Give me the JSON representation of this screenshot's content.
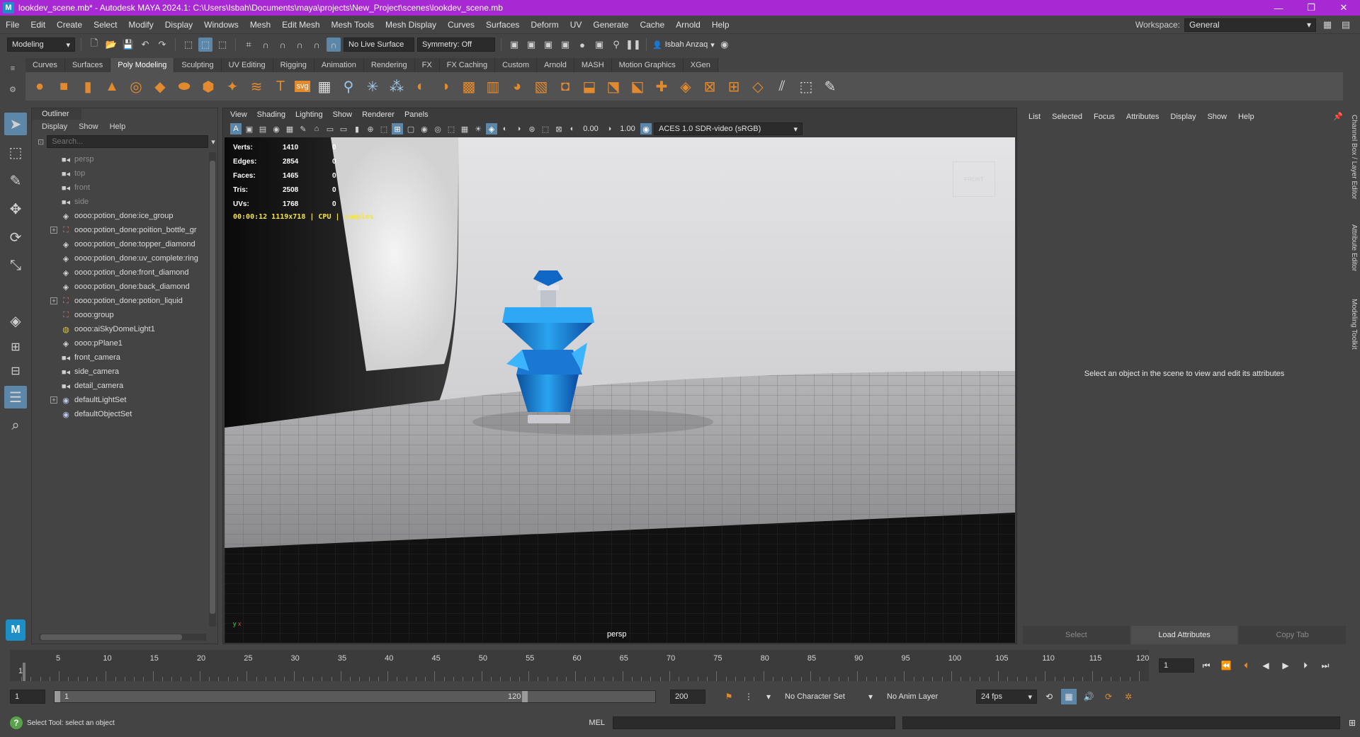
{
  "window": {
    "title": "lookdev_scene.mb* - Autodesk MAYA 2024.1: C:\\Users\\Isbah\\Documents\\maya\\projects\\New_Project\\scenes\\lookdev_scene.mb",
    "minimize": "—",
    "maximize": "❐",
    "close": "✕"
  },
  "menubar": {
    "items": [
      "File",
      "Edit",
      "Create",
      "Select",
      "Modify",
      "Display",
      "Windows",
      "Mesh",
      "Edit Mesh",
      "Mesh Tools",
      "Mesh Display",
      "Curves",
      "Surfaces",
      "Deform",
      "UV",
      "Generate",
      "Cache",
      "Arnold",
      "Help"
    ],
    "workspace_label": "Workspace:",
    "workspace_value": "General"
  },
  "statusline": {
    "menu_set": "Modeling",
    "live_surface": "No Live Surface",
    "symmetry": "Symmetry: Off",
    "user": "Isbah Anzaq"
  },
  "shelf": {
    "tabs": [
      "Curves",
      "Surfaces",
      "Poly Modeling",
      "Sculpting",
      "UV Editing",
      "Rigging",
      "Animation",
      "Rendering",
      "FX",
      "FX Caching",
      "Custom",
      "Arnold",
      "MASH",
      "Motion Graphics",
      "XGen"
    ],
    "active_tab": "Poly Modeling",
    "svg_label": "svg",
    "text_label": "T"
  },
  "outliner": {
    "title": "Outliner",
    "menu": [
      "Display",
      "Show",
      "Help"
    ],
    "search_placeholder": "Search...",
    "items": [
      {
        "label": "persp",
        "icon": "camera-icon",
        "dim": true,
        "expandable": false
      },
      {
        "label": "top",
        "icon": "camera-icon",
        "dim": true,
        "expandable": false
      },
      {
        "label": "front",
        "icon": "camera-icon",
        "dim": true,
        "expandable": false
      },
      {
        "label": "side",
        "icon": "camera-icon",
        "dim": true,
        "expandable": false
      },
      {
        "label": "oooo:potion_done:ice_group",
        "icon": "transform-icon",
        "dim": false,
        "expandable": false
      },
      {
        "label": "oooo:potion_done:poition_bottle_gr",
        "icon": "group-icon",
        "dim": false,
        "expandable": true
      },
      {
        "label": "oooo:potion_done:topper_diamond",
        "icon": "transform-icon",
        "dim": false,
        "expandable": false
      },
      {
        "label": "oooo:potion_done:uv_complete:ring",
        "icon": "transform-icon",
        "dim": false,
        "expandable": false
      },
      {
        "label": "oooo:potion_done:front_diamond",
        "icon": "transform-icon",
        "dim": false,
        "expandable": false
      },
      {
        "label": "oooo:potion_done:back_diamond",
        "icon": "transform-icon",
        "dim": false,
        "expandable": false
      },
      {
        "label": "oooo:potion_done:potion_liquid",
        "icon": "group-icon",
        "dim": false,
        "expandable": true
      },
      {
        "label": "oooo:group",
        "icon": "group-icon",
        "dim": false,
        "expandable": false
      },
      {
        "label": "oooo:aiSkyDomeLight1",
        "icon": "skydome-icon",
        "dim": false,
        "expandable": false
      },
      {
        "label": "oooo:pPlane1",
        "icon": "transform-icon",
        "dim": false,
        "expandable": false
      },
      {
        "label": "front_camera",
        "icon": "camera-icon",
        "dim": false,
        "expandable": false
      },
      {
        "label": "side_camera",
        "icon": "camera-icon",
        "dim": false,
        "expandable": false
      },
      {
        "label": "detail_camera",
        "icon": "camera-icon",
        "dim": false,
        "expandable": false
      },
      {
        "label": "defaultLightSet",
        "icon": "set-icon",
        "dim": false,
        "expandable": true
      },
      {
        "label": "defaultObjectSet",
        "icon": "set-icon",
        "dim": false,
        "expandable": false
      }
    ]
  },
  "viewport": {
    "menu": [
      "View",
      "Shading",
      "Lighting",
      "Show",
      "Renderer",
      "Panels"
    ],
    "exposure": "0.00",
    "gamma": "1.00",
    "color_space": "ACES 1.0 SDR-video (sRGB)",
    "hud": [
      {
        "key": "Verts:",
        "value": "1410",
        "selected": "0"
      },
      {
        "key": "Edges:",
        "value": "2854",
        "selected": "0"
      },
      {
        "key": "Faces:",
        "value": "1465",
        "selected": "0"
      },
      {
        "key": "Tris:",
        "value": "2508",
        "selected": "0"
      },
      {
        "key": "UVs:",
        "value": "1768",
        "selected": "0"
      }
    ],
    "render_info": "00:00:12 1119x718 | CPU | samples",
    "camera_label": "persp",
    "view_cube": "FRONT"
  },
  "attribute_editor": {
    "menu": [
      "List",
      "Selected",
      "Focus",
      "Attributes",
      "Display",
      "Show",
      "Help"
    ],
    "message": "Select an object in the scene to view and edit its attributes",
    "buttons": {
      "select": "Select",
      "load": "Load Attributes",
      "copy": "Copy Tab"
    },
    "side_tabs": [
      "Channel Box / Layer Editor",
      "Attribute Editor",
      "Modeling Toolkit"
    ]
  },
  "timeline": {
    "labels": [
      "1",
      "5",
      "10",
      "15",
      "20",
      "25",
      "30",
      "35",
      "40",
      "45",
      "50",
      "55",
      "60",
      "65",
      "70",
      "75",
      "80",
      "85",
      "90",
      "95",
      "100",
      "105",
      "110",
      "115",
      "120"
    ],
    "current_frame": "1"
  },
  "range": {
    "start": "1",
    "inner_start": "1",
    "inner_end": "120",
    "end": "200",
    "character_set": "No Character Set",
    "anim_layer": "No Anim Layer",
    "fps": "24 fps"
  },
  "commandline": {
    "help_text": "Select Tool: select an object",
    "mel_label": "MEL"
  }
}
